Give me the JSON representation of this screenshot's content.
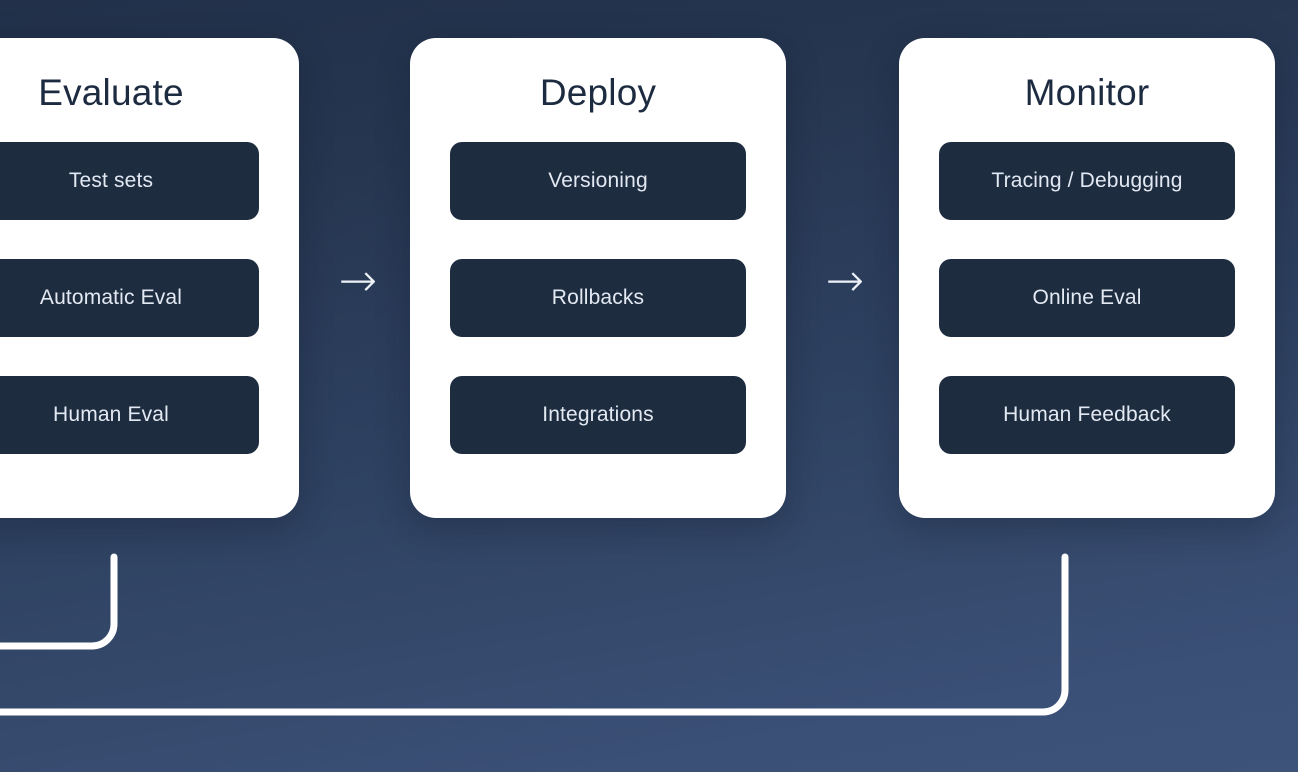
{
  "diagram": {
    "title_flow": [
      "Evaluate",
      "Deploy",
      "Monitor"
    ],
    "background": {
      "top_color": "#22304a",
      "bottom_color": "#3d5379"
    },
    "card_bg": "#ffffff",
    "pill_bg": "#1e2c40",
    "pill_text_color": "#e3e9f2",
    "heading_color": "#1d2b40",
    "connector_color": "#ffffff"
  },
  "cards": [
    {
      "title": "Evaluate",
      "items": [
        {
          "label": "Test sets"
        },
        {
          "label": "Automatic Eval"
        },
        {
          "label": "Human Eval"
        }
      ]
    },
    {
      "title": "Deploy",
      "items": [
        {
          "label": "Versioning"
        },
        {
          "label": "Rollbacks"
        },
        {
          "label": "Integrations"
        }
      ]
    },
    {
      "title": "Monitor",
      "items": [
        {
          "label": "Tracing / Debugging"
        },
        {
          "label": "Online Eval"
        },
        {
          "label": "Human Feedback"
        }
      ]
    }
  ],
  "arrows": [
    {
      "glyph": "→"
    },
    {
      "glyph": "→"
    }
  ]
}
